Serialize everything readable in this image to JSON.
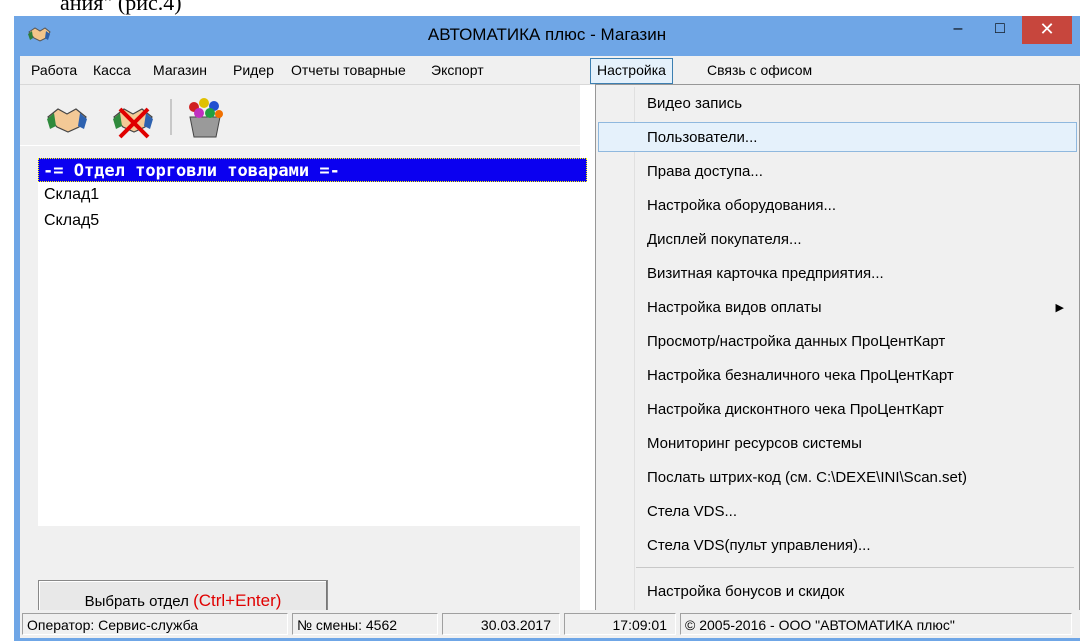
{
  "caption_fragment": "ания\" (рис.4)",
  "window": {
    "title": "АВТОМАТИКА плюс - Магазин",
    "minimize_label": "–",
    "maximize_label": "□",
    "close_label": "✕"
  },
  "menubar": {
    "items": [
      "Работа",
      "Касса",
      "Магазин",
      "Ридер",
      "Отчеты товарные",
      "Экспорт",
      "Настройка",
      "Связь с офисом"
    ]
  },
  "toolbar": {
    "buttons": [
      "handshake-icon",
      "handshake-cancel-icon",
      "flower-basket-icon"
    ]
  },
  "departments": {
    "items": [
      "-= Отдел торговли товарами =-",
      "Склад1",
      "Склад5"
    ]
  },
  "select_button": {
    "label": "Выбрать отдел ",
    "hotkey": "(Ctrl+Enter)"
  },
  "settings_menu": {
    "items": [
      "Видео запись",
      "Пользователи...",
      "Права доступа...",
      "Настройка оборудования...",
      "Дисплей покупателя...",
      "Визитная карточка предприятия...",
      "Настройка видов оплаты",
      "Просмотр/настройка данных ПроЦентКарт",
      "Настройка безналичного чека ПроЦентКарт",
      "Настройка дисконтного чека ПроЦентКарт",
      "Мониторинг ресурсов системы",
      "Послать штрих-код (см. C:\\DEXE\\INI\\Scan.set)",
      "Стела VDS...",
      "Стела VDS(пульт управления)...",
      "Настройка бонусов и скидок"
    ]
  },
  "statusbar": {
    "operator": "Оператор: Сервис-служба",
    "shift": "№ смены: 4562",
    "date": "30.03.2017",
    "time": "17:09:01",
    "copyright": "© 2005-2016 - ООО \"АВТОМАТИКА плюс\""
  },
  "colors": {
    "titlebar": "#6fa6e6",
    "selection": "#0b00f0",
    "close": "#c7463d",
    "hotkey": "#e00000"
  }
}
